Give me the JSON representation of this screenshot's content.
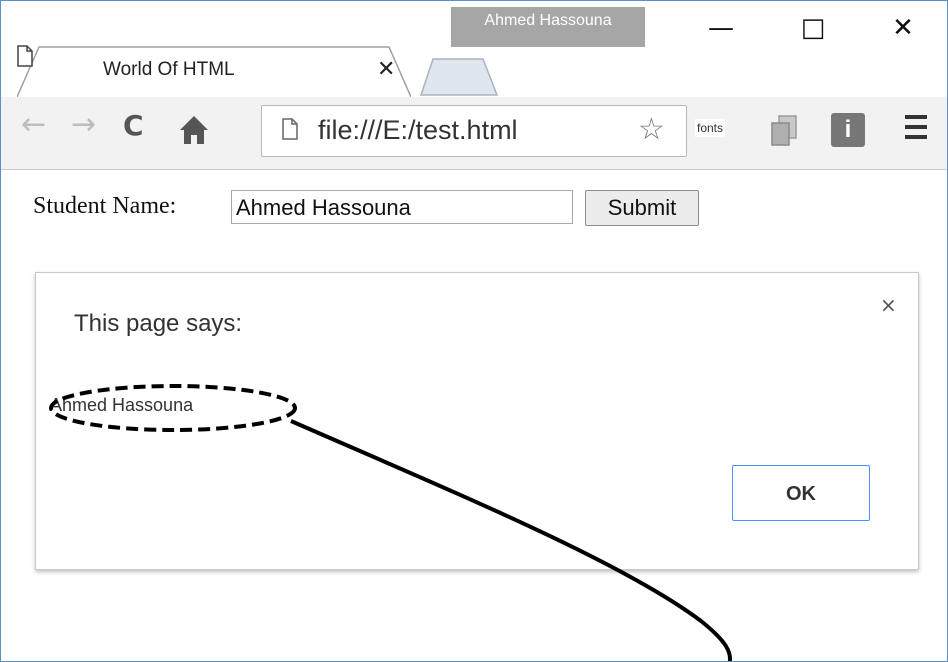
{
  "window": {
    "profile_name": "Ahmed Hassouna",
    "minimize_glyph": "—",
    "maximize_glyph": "□",
    "close_glyph": "✕"
  },
  "tab": {
    "title": "World Of HTML",
    "close_glyph": "✕"
  },
  "toolbar": {
    "back_glyph": "←",
    "forward_glyph": "→",
    "reload_glyph": "C",
    "home_glyph": "🏠",
    "url": "file:///E:/test.html",
    "star_glyph": "☆",
    "extension_fonts_label": "fonts",
    "extension_info_label": "i"
  },
  "form": {
    "label": "Student Name:",
    "input_value": "Ahmed Hassouna",
    "button_label": "Submit"
  },
  "dialog": {
    "title": "This page says:",
    "message": "Ahmed Hassouna",
    "close_glyph": "×",
    "ok_label": "OK"
  },
  "colors": {
    "window_border": "#5b8fc7",
    "profile_bg": "#a6a6a6",
    "toolbar_bg": "#f2f2f2",
    "dialog_ok_border": "#4d90fe"
  }
}
